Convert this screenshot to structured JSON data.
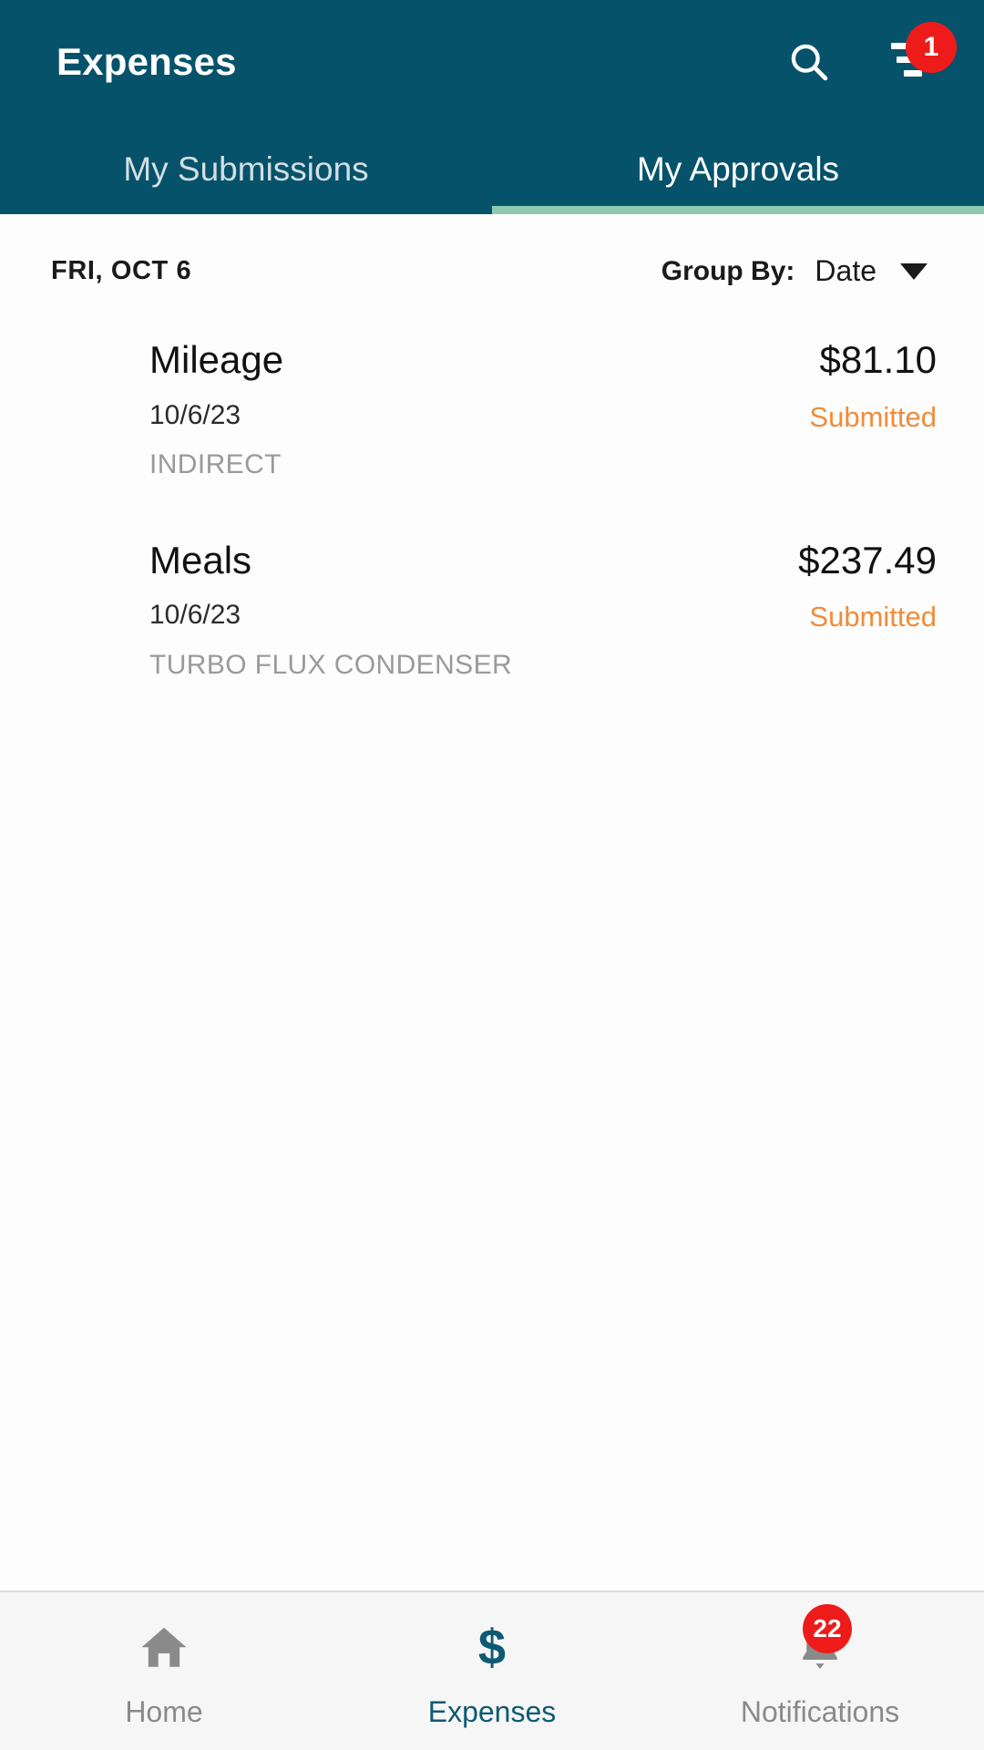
{
  "header": {
    "title": "Expenses",
    "search_icon": "search-icon",
    "filter_icon": "filter-icon",
    "filter_badge": "1",
    "background_color": "#06526b",
    "badge_color": "#ee1b1b"
  },
  "tabs": [
    {
      "label": "My Submissions",
      "active": false
    },
    {
      "label": "My Approvals",
      "active": true
    }
  ],
  "tab_indicator_color": "#8fc9b2",
  "group_bar": {
    "date_label": "FRI, OCT 6",
    "group_by_label": "Group By:",
    "group_by_value": "Date",
    "caret_icon": "chevron-down-icon"
  },
  "expenses": [
    {
      "title": "Mileage",
      "date": "10/6/23",
      "category": "INDIRECT",
      "amount": "$81.10",
      "status": "Submitted",
      "status_color": "#f08c3a"
    },
    {
      "title": "Meals",
      "date": "10/6/23",
      "category": "TURBO FLUX CONDENSER",
      "amount": "$237.49",
      "status": "Submitted",
      "status_color": "#f08c3a"
    }
  ],
  "bottom_nav": [
    {
      "label": "Home",
      "icon": "home-icon",
      "active": false,
      "badge": null
    },
    {
      "label": "Expenses",
      "icon": "dollar-icon",
      "active": true,
      "badge": null
    },
    {
      "label": "Notifications",
      "icon": "bell-icon",
      "active": false,
      "badge": "22"
    }
  ],
  "accent_color": "#0d5a72"
}
